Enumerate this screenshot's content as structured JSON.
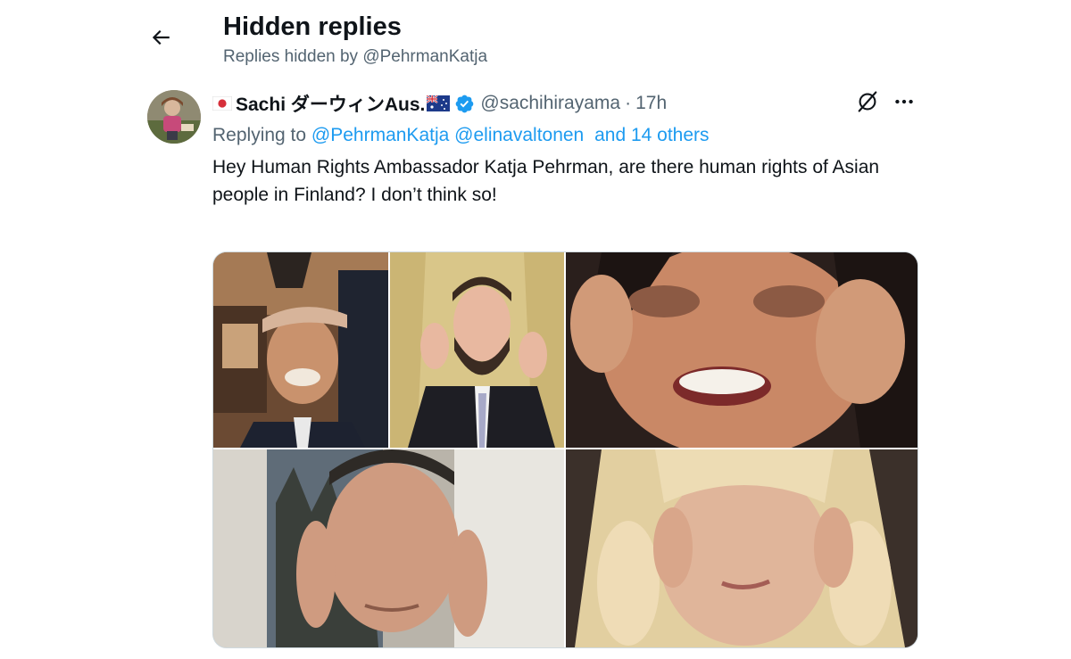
{
  "header": {
    "title": "Hidden replies",
    "subtitle": "Replies hidden by @PehrmanKatja"
  },
  "tweet": {
    "display_name": "Sachi ダーウィンAus.",
    "handle": "@sachihirayama",
    "separator": "·",
    "time": "17h",
    "replying_prefix": "Replying to",
    "mentions": [
      "@PehrmanKatja",
      "@elinavaltonen"
    ],
    "others": "and 14 others",
    "text": "Hey Human Rights Ambassador Katja Pehrman, are there human rights of Asian people in Finland? I don’t think so!"
  },
  "icons": {
    "back": "arrow-left-icon",
    "jp_flag": "japan-flag-icon",
    "au_flag": "australia-flag-icon",
    "verified": "verified-badge-icon",
    "hide": "hide-reply-icon",
    "more": "more-dots-icon"
  },
  "colors": {
    "accent": "#1d9bf0",
    "secondary_text": "#536471",
    "primary_text": "#0f1419",
    "border": "#cfd9de"
  }
}
